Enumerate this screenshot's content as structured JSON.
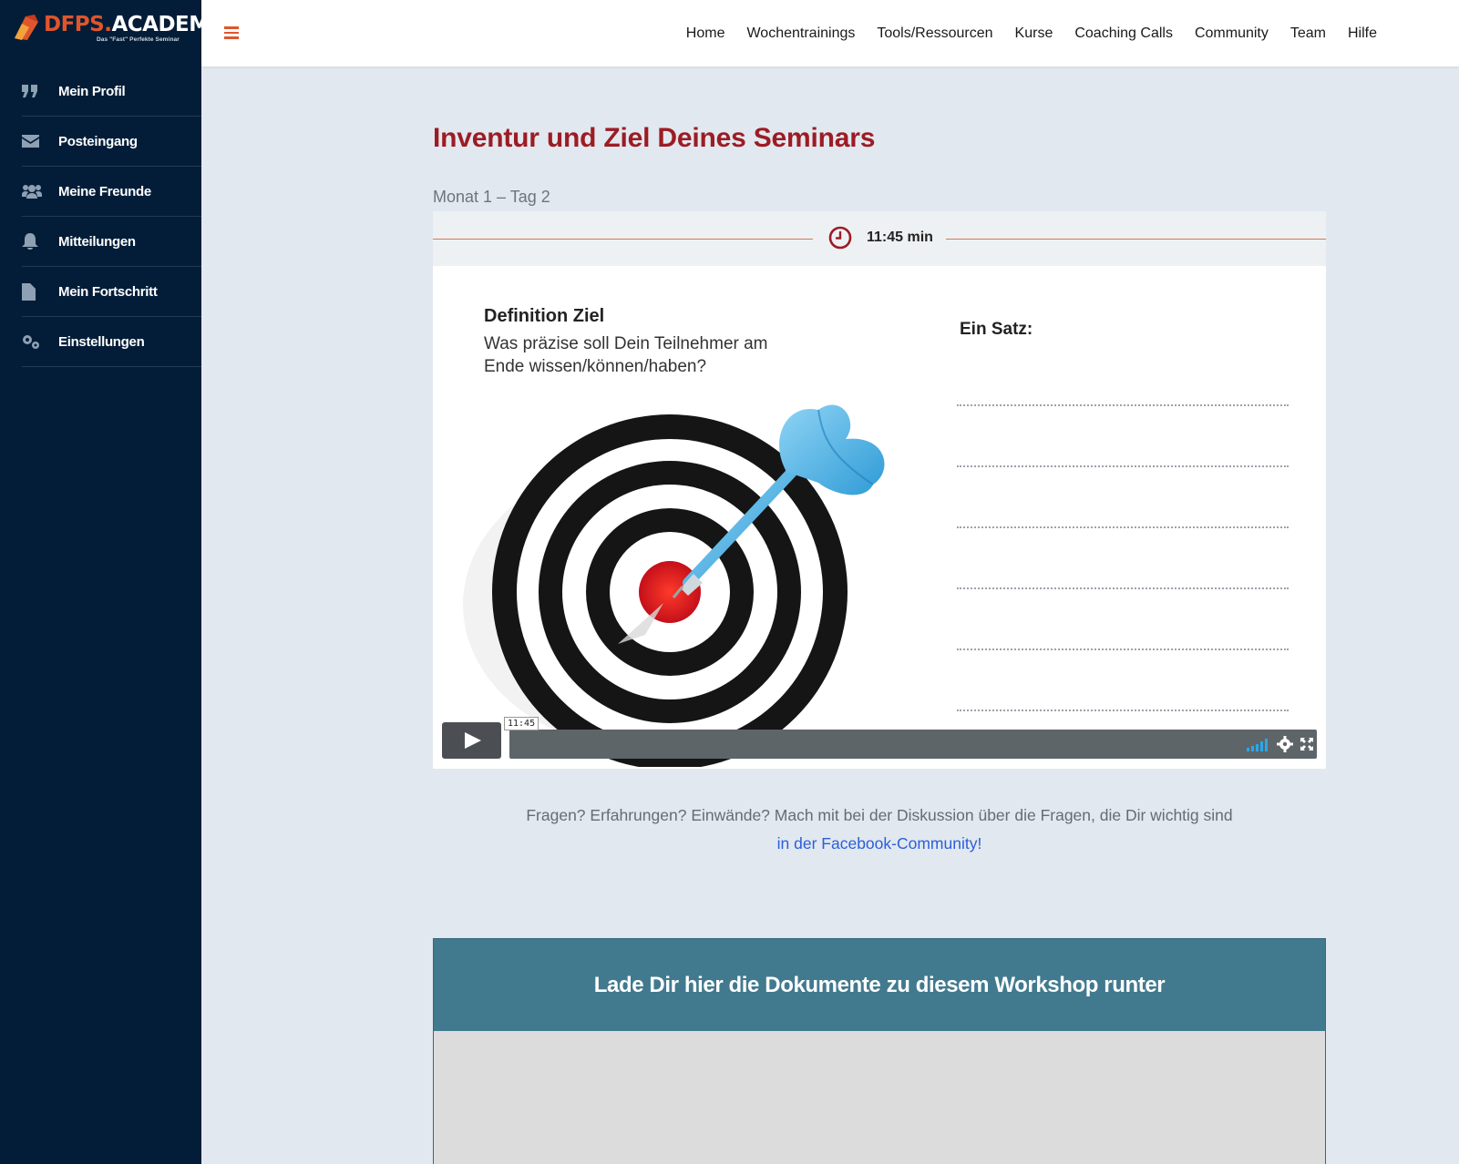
{
  "brand": {
    "name_part1": "DFPS.",
    "name_part2": "ACADEMY",
    "tagline": "Das \"Fast\" Perfekte Seminar",
    "accent_color": "#e0552b"
  },
  "sidebar": {
    "items": [
      {
        "label": "Mein Profil",
        "icon": "quote-icon"
      },
      {
        "label": "Posteingang",
        "icon": "envelope-icon"
      },
      {
        "label": "Meine Freunde",
        "icon": "users-icon"
      },
      {
        "label": "Mitteilungen",
        "icon": "bell-icon"
      },
      {
        "label": "Mein Fortschritt",
        "icon": "file-icon"
      },
      {
        "label": "Einstellungen",
        "icon": "gears-icon"
      }
    ]
  },
  "header": {
    "nav": [
      "Home",
      "Wochentrainings",
      "Tools/Ressourcen",
      "Kurse",
      "Coaching Calls",
      "Community",
      "Team",
      "Hilfe"
    ]
  },
  "main": {
    "title": "Inventur und Ziel Deines Seminars",
    "subtitle": "Monat 1 – Tag 2",
    "duration": "11:45 min",
    "video": {
      "slide_heading": "Definition Ziel",
      "slide_question": "Was präzise soll Dein Teilnehmer am Ende wissen/können/haben?",
      "slide_right_label": "Ein Satz:",
      "time_tooltip": "11:45",
      "progress": 0
    },
    "discussion_text": "Fragen? Erfahrungen? Einwände? Mach mit bei der Diskussion über die Fragen, die Dir wichtig sind",
    "discussion_link": "in der Facebook-Community!",
    "docs_heading": "Lade Dir hier die Dokumente zu diesem Workshop runter"
  },
  "colors": {
    "sidebar_bg": "#031d38",
    "title_red": "#9c1c24",
    "docs_header": "#417a8f",
    "link_blue": "#2a5fdb"
  }
}
